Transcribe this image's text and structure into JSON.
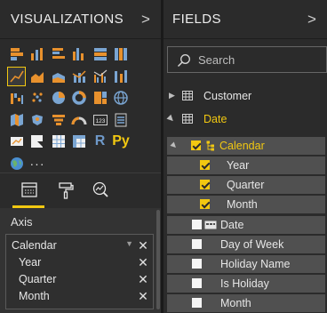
{
  "visualizations": {
    "title": "VISUALIZATIONS",
    "collapse_glyph": ">",
    "extra_labels": {
      "r_visual": "R",
      "python_visual": "Py",
      "more": "···"
    }
  },
  "axis": {
    "title": "Axis",
    "items": [
      {
        "label": "Calendar",
        "remove": "✕"
      },
      {
        "label": "Year",
        "remove": "✕"
      },
      {
        "label": "Quarter",
        "remove": "✕"
      },
      {
        "label": "Month",
        "remove": "✕"
      }
    ]
  },
  "fields": {
    "title": "FIELDS",
    "collapse_glyph": ">",
    "search": {
      "placeholder": "Search",
      "value": ""
    },
    "tables": [
      {
        "name": "Customer",
        "expanded": false
      },
      {
        "name": "Date",
        "expanded": true
      }
    ],
    "hierarchy": {
      "name": "Calendar",
      "checked": true
    },
    "hierarchy_levels": [
      {
        "name": "Year",
        "checked": true
      },
      {
        "name": "Quarter",
        "checked": true
      },
      {
        "name": "Month",
        "checked": true
      }
    ],
    "columns": [
      {
        "name": "Date",
        "checked": false
      },
      {
        "name": "Day of Week",
        "checked": false
      },
      {
        "name": "Holiday Name",
        "checked": false
      },
      {
        "name": "Is Holiday",
        "checked": false
      },
      {
        "name": "Month",
        "checked": false
      }
    ]
  },
  "colors": {
    "accent": "#f2c811",
    "pane_bg": "#2b2b2b",
    "row_bg": "#505050"
  }
}
